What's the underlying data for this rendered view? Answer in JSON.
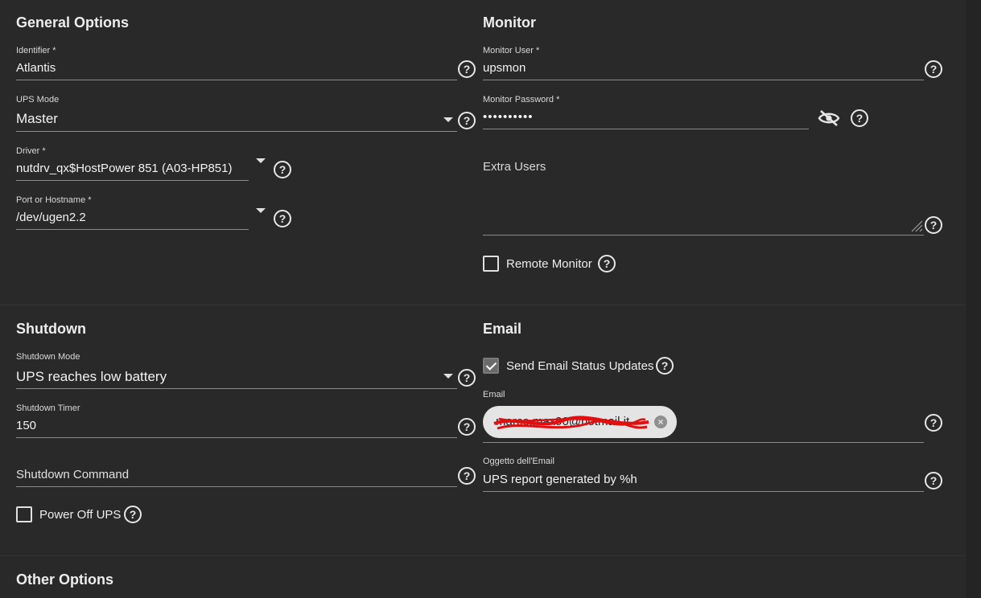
{
  "general": {
    "title": "General Options",
    "identifier": {
      "label": "Identifier *",
      "value": "Atlantis"
    },
    "ups_mode": {
      "label": "UPS Mode",
      "value": "Master"
    },
    "driver": {
      "label": "Driver *",
      "value": "nutdrv_qx$HostPower 851 (A03-HP851)"
    },
    "port": {
      "label": "Port or Hostname *",
      "value": "/dev/ugen2.2"
    }
  },
  "monitor": {
    "title": "Monitor",
    "user": {
      "label": "Monitor User *",
      "value": "upsmon"
    },
    "password": {
      "label": "Monitor Password *",
      "value": "••••••••••"
    },
    "extra_users": {
      "placeholder": "Extra Users",
      "value": ""
    },
    "remote_monitor": {
      "label": "Remote Monitor",
      "checked": false
    }
  },
  "shutdown": {
    "title": "Shutdown",
    "mode": {
      "label": "Shutdown Mode",
      "value": "UPS reaches low battery"
    },
    "timer": {
      "label": "Shutdown Timer",
      "value": "150"
    },
    "command": {
      "placeholder": "Shutdown Command",
      "value": ""
    },
    "power_off": {
      "label": "Power Off UPS",
      "checked": false
    }
  },
  "email": {
    "title": "Email",
    "send_updates": {
      "label": "Send Email Status Updates",
      "checked": true
    },
    "address": {
      "label": "Email",
      "chip": "marco.max90@hotmail.it"
    },
    "subject": {
      "label": "Oggetto dell'Email",
      "value": "UPS report generated by %h"
    }
  },
  "other": {
    "title": "Other Options"
  },
  "icons": {
    "help": "help-circle-icon",
    "caret": "arrow-drop-down-icon",
    "visibility": "visibility-off-icon",
    "remove": "cancel-icon"
  },
  "colors": {
    "background": "#292929",
    "text": "#e8e8e8",
    "underline": "#8a8a8a",
    "chip": "#e4e4e4"
  }
}
